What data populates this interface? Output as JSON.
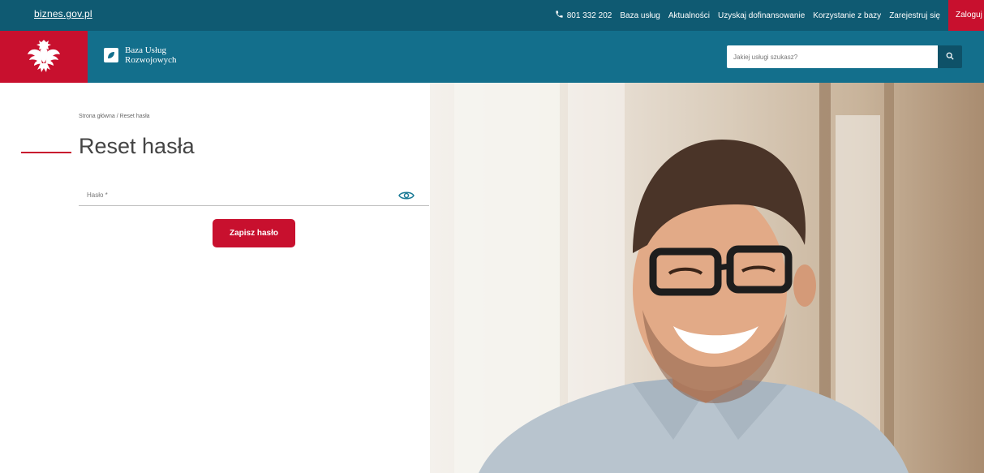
{
  "topbar": {
    "site_link": "biznes.gov.pl",
    "phone": "801 332 202",
    "nav": [
      "Baza usług",
      "Aktualności",
      "Uzyskaj dofinansowanie",
      "Korzystanie z bazy",
      "Zarejestruj się"
    ],
    "login": "Zaloguj"
  },
  "header": {
    "brand_line1": "Baza Usług",
    "brand_line2": "Rozwojowych",
    "search_placeholder": "Jakiej usługi szukasz?"
  },
  "content": {
    "breadcrumb": "Strona główna / Reset hasła",
    "title": "Reset hasła",
    "password_label": "Hasło *",
    "save_button": "Zapisz hasło"
  },
  "colors": {
    "topbar": "#0f5a72",
    "header": "#136f8c",
    "accent_red": "#c8102e"
  },
  "icons": [
    "phone-icon",
    "eagle-emblem-icon",
    "leaf-logo-icon",
    "search-icon",
    "eye-icon"
  ]
}
